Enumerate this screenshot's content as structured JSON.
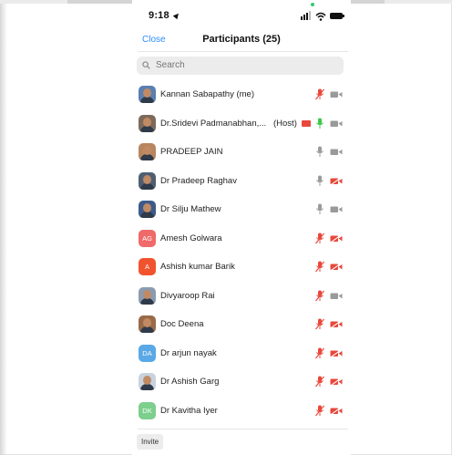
{
  "status_bar": {
    "time": "9:18"
  },
  "nav": {
    "close_label": "Close",
    "title": "Participants (25)"
  },
  "search": {
    "placeholder": "Search"
  },
  "participants": [
    {
      "name": "Kannan Sabapathy (me)",
      "avatar": "photo",
      "avatar_color": "#5a7fb0",
      "mic": "muted",
      "video": "off"
    },
    {
      "name": "Dr.Sridevi Padmanabhan,...",
      "host": "(Host)",
      "recording": true,
      "avatar": "photo",
      "avatar_color": "#7d6a5a",
      "mic": "active",
      "video": "off"
    },
    {
      "name": "PRADEEP JAIN",
      "avatar": "photo",
      "avatar_color": "#b8865e",
      "mic": "off",
      "video": "off"
    },
    {
      "name": "Dr Pradeep Raghav",
      "avatar": "photo",
      "avatar_color": "#4e5f72",
      "mic": "off",
      "video": "muted"
    },
    {
      "name": "Dr Silju Mathew",
      "avatar": "photo",
      "avatar_color": "#3d5a8a",
      "mic": "off",
      "video": "off"
    },
    {
      "name": "Amesh Golwara",
      "avatar": "initials",
      "initials": "AG",
      "avatar_color": "#f06a6a",
      "mic": "muted",
      "video": "muted"
    },
    {
      "name": "Ashish kumar Barik",
      "avatar": "initials",
      "initials": "A",
      "avatar_color": "#f2532f",
      "mic": "muted",
      "video": "muted"
    },
    {
      "name": "Divyaroop Rai",
      "avatar": "photo",
      "avatar_color": "#8a9bb0",
      "mic": "muted",
      "video": "off"
    },
    {
      "name": "Doc Deena",
      "avatar": "photo",
      "avatar_color": "#9a6a48",
      "mic": "muted",
      "video": "muted"
    },
    {
      "name": "Dr arjun nayak",
      "avatar": "initials",
      "initials": "DA",
      "avatar_color": "#5aa9e6",
      "mic": "muted",
      "video": "muted"
    },
    {
      "name": "Dr Ashish Garg",
      "avatar": "photo",
      "avatar_color": "#c9d3de",
      "mic": "muted",
      "video": "muted"
    },
    {
      "name": "Dr Kavitha Iyer",
      "avatar": "initials",
      "initials": "DK",
      "avatar_color": "#7ccf8c",
      "mic": "muted",
      "video": "muted"
    }
  ],
  "footer": {
    "invite_label": "Invite"
  },
  "colors": {
    "accent": "#2d8cff",
    "muted_red": "#e8473b",
    "active_green": "#3cc74a",
    "neutral_gray": "#9a9a9a"
  }
}
